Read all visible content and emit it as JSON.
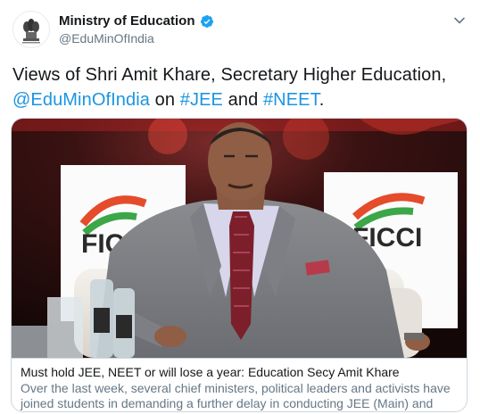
{
  "author": {
    "display_name": "Ministry of Education",
    "handle": "@EduMinOfIndia",
    "avatar_icon": "national-emblem-icon",
    "verified_icon": "verified-badge-icon",
    "menu_icon": "chevron-down-icon"
  },
  "tweet": {
    "text_part1": "Views of Shri Amit Khare, Secretary Higher Education,",
    "mention": "@EduMinOfIndia",
    "text_on": " on ",
    "hashtag1": "#JEE",
    "text_and": " and ",
    "hashtag2": "#NEET",
    "text_end": "."
  },
  "card": {
    "image_description_icon": "article-photo",
    "brand_sign_left": "FICCI",
    "brand_sign_right": "FICCI",
    "title": "Must hold JEE, NEET or will lose a year: Education Secy Amit Khare",
    "description": "Over the last week, several chief ministers, political leaders and activists have joined students in demanding a further delay in conducting JEE (Main) and NEET."
  },
  "colors": {
    "link": "#1b95e0",
    "verified": "#1da1f2",
    "secondary_text": "#657786",
    "border": "#ccd6dd"
  }
}
